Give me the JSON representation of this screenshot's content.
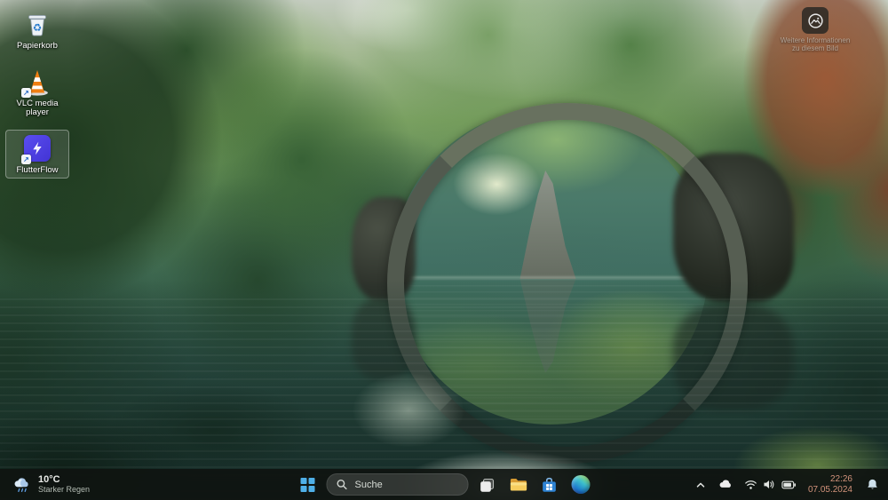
{
  "desktop": {
    "icons": [
      {
        "id": "recycle-bin",
        "label": "Papierkorb"
      },
      {
        "id": "vlc",
        "label": "VLC media player"
      },
      {
        "id": "flutterflow",
        "label": "FlutterFlow"
      }
    ],
    "spotlight": {
      "caption_line1": "Weitere Informationen",
      "caption_line2": "zu diesem Bild"
    }
  },
  "taskbar": {
    "weather": {
      "temp": "10°C",
      "condition": "Starker Regen"
    },
    "search": {
      "placeholder": "Suche"
    },
    "clock": {
      "time": "22:26",
      "date": "07.05.2024"
    }
  },
  "colors": {
    "taskbar_bg": "rgba(15,19,16,0.92)",
    "start_blue": "#4fb0e8",
    "clock_text": "#d2937b",
    "flutterflow_purple": "#4b39ef",
    "vlc_orange": "#f07f13"
  }
}
